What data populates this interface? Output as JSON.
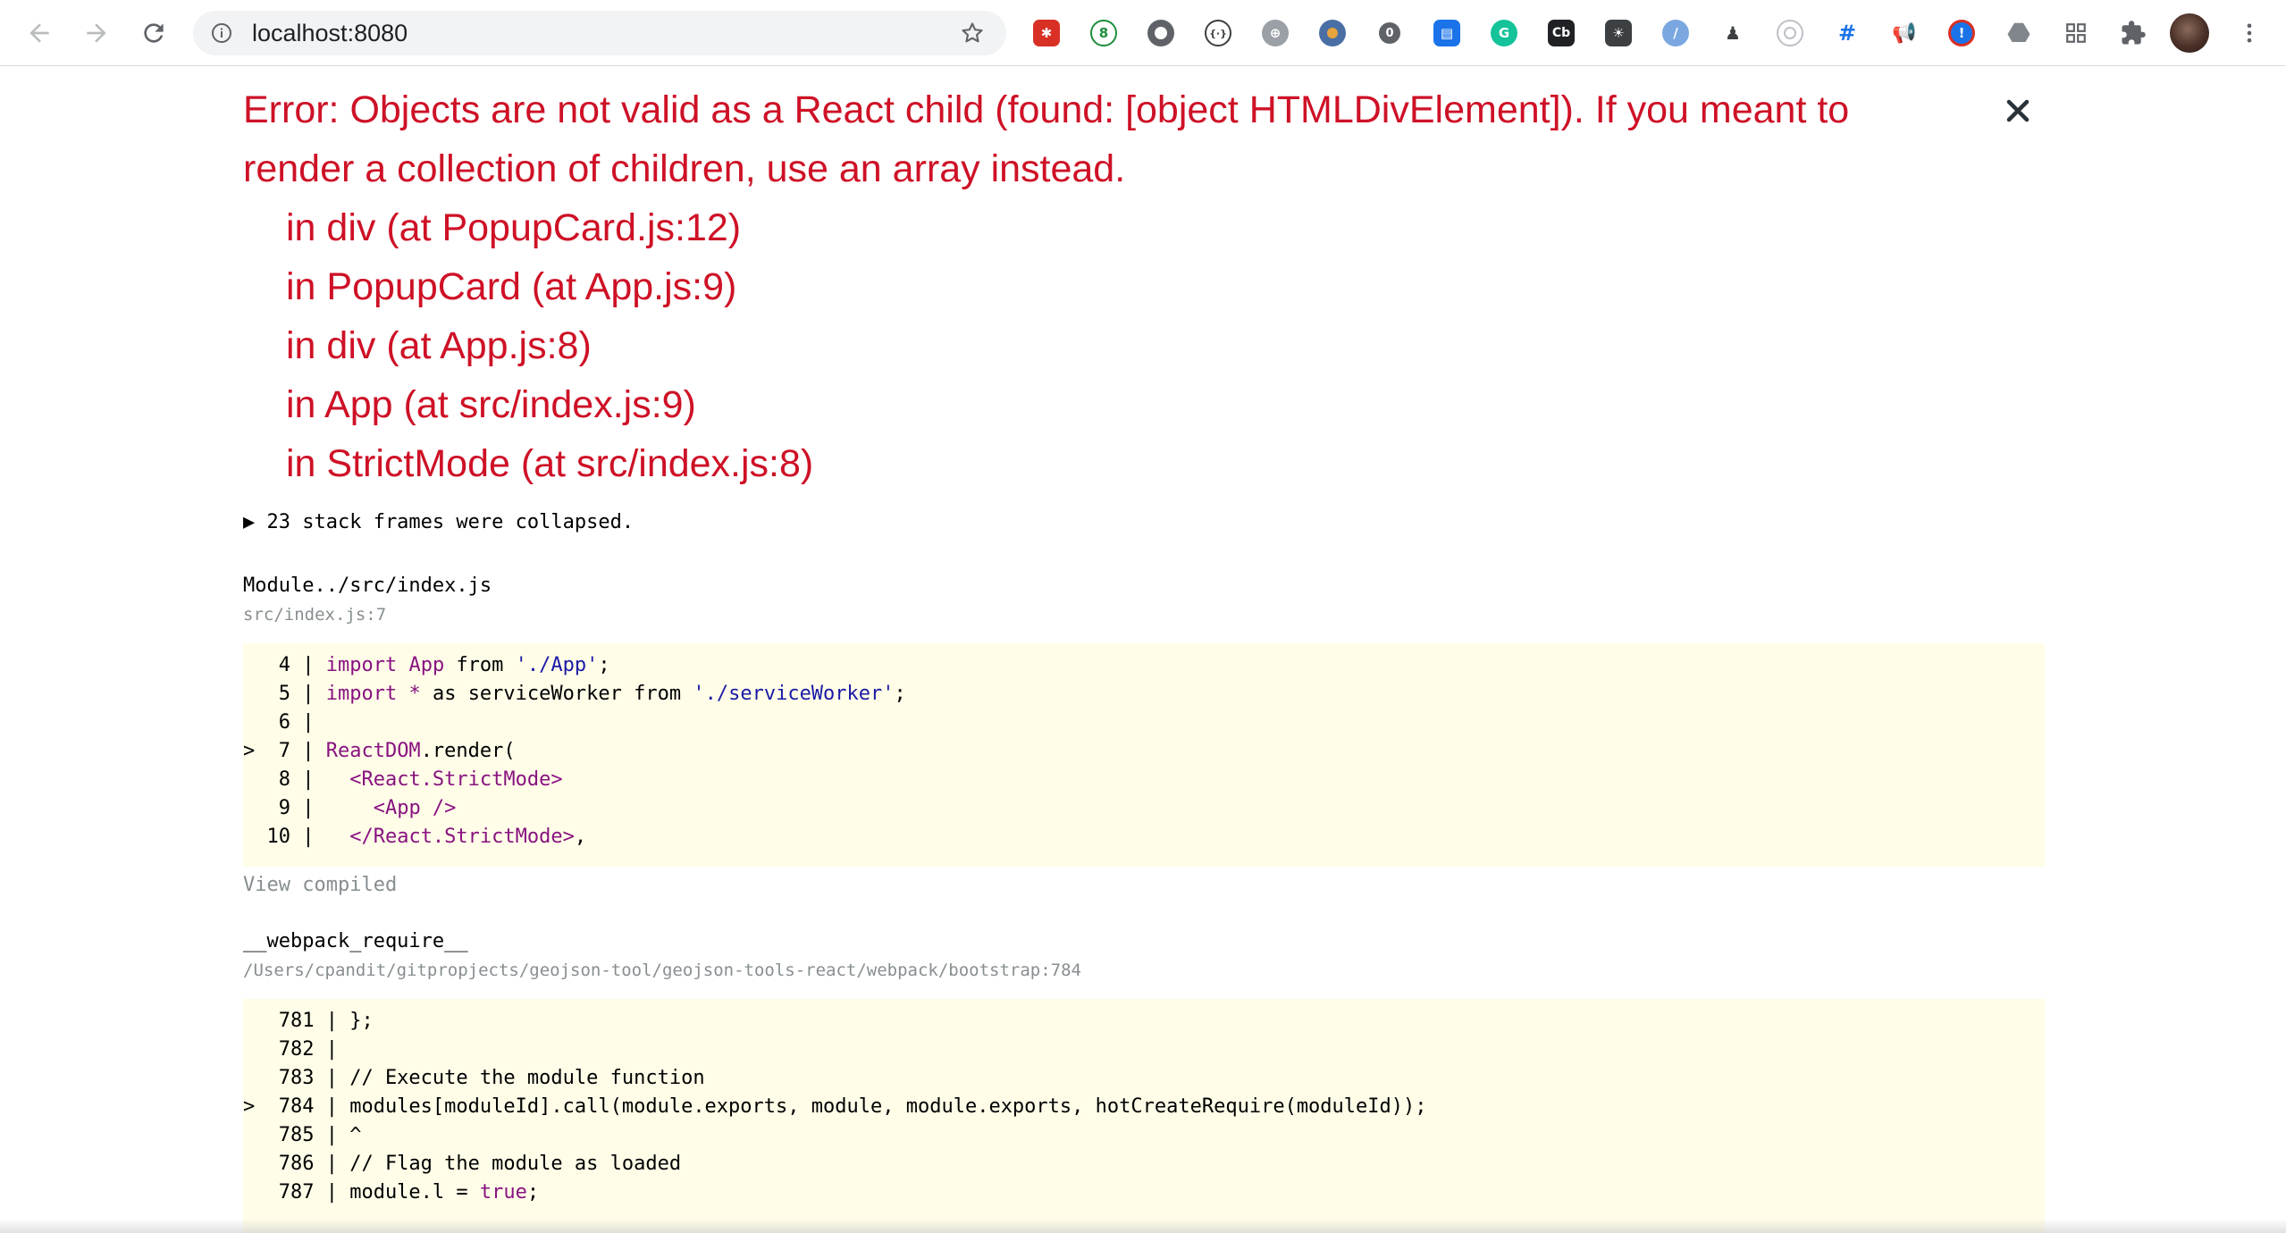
{
  "browser": {
    "url": "localhost:8080"
  },
  "error": {
    "message": "Error: Objects are not valid as a React child (found: [object HTMLDivElement]). If you meant to render a collection of children, use an array instead.",
    "component_stack": [
      "in div (at PopupCard.js:12)",
      "in PopupCard (at App.js:9)",
      "in div (at App.js:8)",
      "in App (at src/index.js:9)",
      "in StrictMode (at src/index.js:8)"
    ],
    "collapsed_label": "▶ 23 stack frames were collapsed.",
    "close_glyph": "✕"
  },
  "frames": [
    {
      "name": "Module../src/index.js",
      "location": "src/index.js:7",
      "view_compiled": "View compiled"
    },
    {
      "name": "__webpack_require__",
      "location": "/Users/cpandit/gitpropjects/geojson-tool/geojson-tools-react/webpack/bootstrap:784"
    }
  ],
  "code1": {
    "l4_gutter": "   4 | ",
    "l4_kw": "import",
    "l4_a": " App ",
    "l4_from": "from",
    "l4_sp": " ",
    "l4_str": "'./App'",
    "l4_end": ";",
    "l5_gutter": "   5 | ",
    "l5_kw": "import",
    "l5_a": " * ",
    "l5_b": "as serviceWorker ",
    "l5_from": "from",
    "l5_sp": " ",
    "l5_str": "'./serviceWorker'",
    "l5_end": ";",
    "l6": "   6 |",
    "l7_gutter": ">  7 | ",
    "l7_obj": "ReactDOM",
    "l7_rest": ".render(",
    "l8_gutter": "   8 |   ",
    "l8_tag": "<React.StrictMode>",
    "l9_gutter": "   9 |     ",
    "l9_tag": "<App />",
    "l10_gutter": "  10 |   ",
    "l10_tag": "</React.StrictMode>",
    "l10_end": ","
  },
  "code2": {
    "l781": "   781 | };",
    "l782": "   782 |",
    "l783": "   783 | // Execute the module function",
    "l784": ">  784 | modules[moduleId].call(module.exports, module, module.exports, hotCreateRequire(moduleId));",
    "l785": "   785 | ^",
    "l786": "   786 | // Flag the module as loaded",
    "l787_gutter": "   787 | module.l = ",
    "l787_kw": "true",
    "l787_end": ";"
  },
  "colors": {
    "error_red": "#ce1126",
    "code_bg": "#fffde8",
    "muted": "#878e91"
  }
}
